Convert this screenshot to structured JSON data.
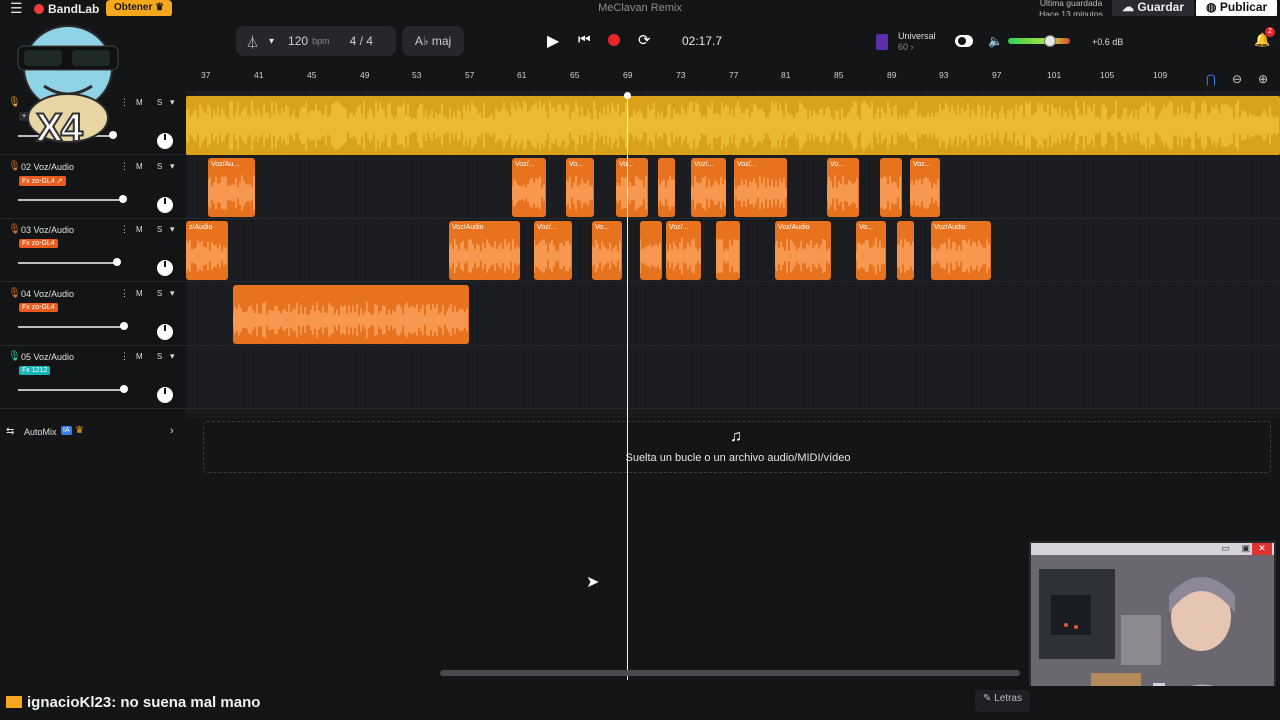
{
  "app": {
    "brand": "BandLab",
    "get_label": "Obtener",
    "project_title": "MeClavan Remix",
    "save_status_line1": "Última guardada",
    "save_status_line2": "Hace 13 minutos",
    "save_label": "Guardar",
    "publish_label": "Publicar"
  },
  "transport": {
    "tempo": "120",
    "tempo_unit": "bpm",
    "time_signature": "4 / 4",
    "key": "A♭ maj",
    "time": "02:17.7",
    "universal_label": "Universal",
    "universal_sub": "60 ›",
    "volume_db": "+0.6 dB",
    "volume_level": 0.68,
    "notification_count": "2"
  },
  "ruler": {
    "bars": [
      "37",
      "41",
      "45",
      "49",
      "53",
      "57",
      "61",
      "65",
      "69",
      "73",
      "77",
      "81",
      "85",
      "89",
      "93",
      "97",
      "101",
      "105",
      "109"
    ]
  },
  "tracks": [
    {
      "name": "",
      "fx": "+ Fx",
      "fx_color": "#2a2b2e",
      "mic_color": "#f5a81d",
      "volume": 0.9
    },
    {
      "name": "02  Voz/Audio",
      "fx": "Fx zo-GL4 ↗",
      "fx_color": "#e85d1f",
      "mic_color": "#e8731f",
      "volume": 0.99
    },
    {
      "name": "03  Voz/Audio",
      "fx": "Fx zo-GL4",
      "fx_color": "#e85d1f",
      "mic_color": "#e8731f",
      "volume": 0.93
    },
    {
      "name": "04  Voz/Audio",
      "fx": "Fx zo-GL4",
      "fx_color": "#e85d1f",
      "mic_color": "#e8731f",
      "volume": 1.0
    },
    {
      "name": "05  Voz/Audio",
      "fx": "Fx 1212",
      "fx_color": "#18b6b9",
      "mic_color": "#2fd3a7",
      "volume": 1.0
    }
  ],
  "track_ms_label": "M S",
  "clips": {
    "lane2": [
      {
        "label": "Voz/Au..."
      },
      {
        "label": "Voz/..."
      },
      {
        "label": "Vo..."
      },
      {
        "label": "Vo..."
      },
      {
        "label": ""
      },
      {
        "label": "Voz/..."
      },
      {
        "label": "Voz/..."
      },
      {
        "label": "Vo..."
      },
      {
        "label": ""
      },
      {
        "label": "Voz..."
      }
    ],
    "lane3": [
      {
        "label": "z/Audio"
      },
      {
        "label": "Voz/Audio"
      },
      {
        "label": "Voz/..."
      },
      {
        "label": "Vo..."
      },
      {
        "label": ""
      },
      {
        "label": "Voz/..."
      },
      {
        "label": ""
      },
      {
        "label": "Voz/Audio"
      },
      {
        "label": "Vo..."
      },
      {
        "label": ""
      },
      {
        "label": "Voz/Audio"
      }
    ],
    "lane4": [
      {
        "label": ""
      }
    ]
  },
  "automix": {
    "label": "AutoMix",
    "badge": "IA"
  },
  "dropzone": {
    "text": "Suelta un bucle o un archivo audio/MIDI/vídeo"
  },
  "overlay": {
    "multiplier": "X4"
  },
  "chat": {
    "user": "ignacioKl23",
    "message": ": no suena mal mano"
  },
  "lyrics_label": "Letras",
  "icons": {
    "menu": "hamburger-icon",
    "metronome": "metronome-icon",
    "play": "play-icon",
    "rewind": "rewind-icon",
    "record": "record-icon",
    "loop": "loop-icon",
    "volume": "speaker-icon",
    "bell": "bell-icon",
    "magnet": "magnet-icon",
    "zoom_out": "zoom-out-icon",
    "zoom_in": "zoom-in-icon",
    "drop": "music-note-icon"
  }
}
